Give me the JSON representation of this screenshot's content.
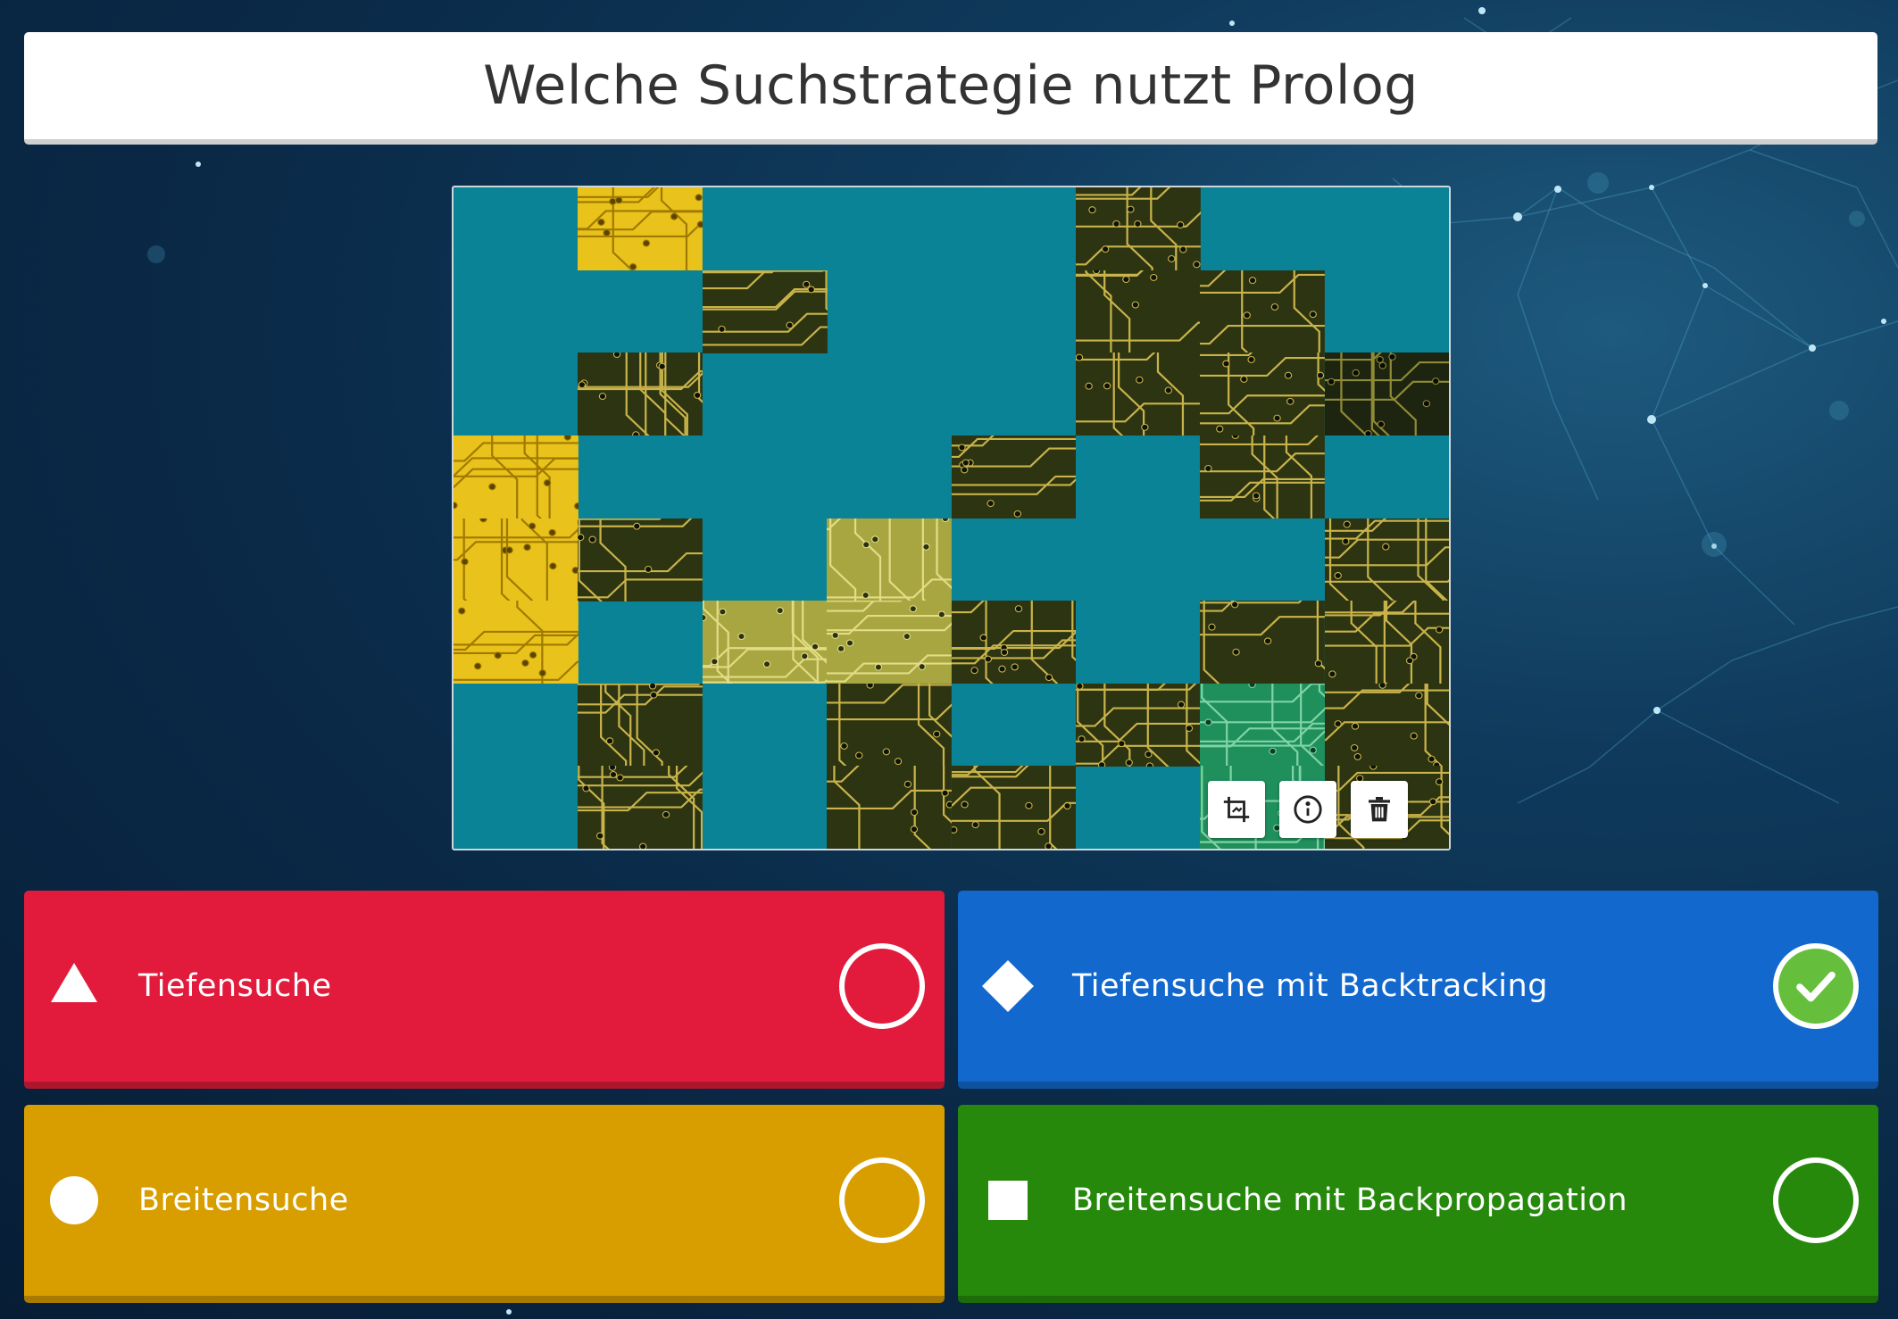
{
  "question": {
    "title": "Welche Suchstrategie nutzt Prolog"
  },
  "media": {
    "image_icon": "circuit-board-puzzle-image",
    "tools": [
      {
        "name": "crop-image-icon"
      },
      {
        "name": "info-icon"
      },
      {
        "name": "trash-icon"
      }
    ],
    "placeholder_color": "#0a8396"
  },
  "answers": [
    {
      "id": "red",
      "shape": "triangle-icon",
      "label": "Tiefensuche",
      "color": "#e21b3c",
      "correct": false
    },
    {
      "id": "blue",
      "shape": "diamond-icon",
      "label": "Tiefensuche mit Backtracking",
      "color": "#1368ce",
      "correct": true
    },
    {
      "id": "yellow",
      "shape": "circle-icon",
      "label": "Breitensuche",
      "color": "#d89e00",
      "correct": false
    },
    {
      "id": "green",
      "shape": "square-icon",
      "label": "Breitensuche mit Backpropagation",
      "color": "#26890c",
      "correct": false
    }
  ],
  "colors": {
    "check_correct": "#66bf3c",
    "background": "#0a2a48"
  }
}
